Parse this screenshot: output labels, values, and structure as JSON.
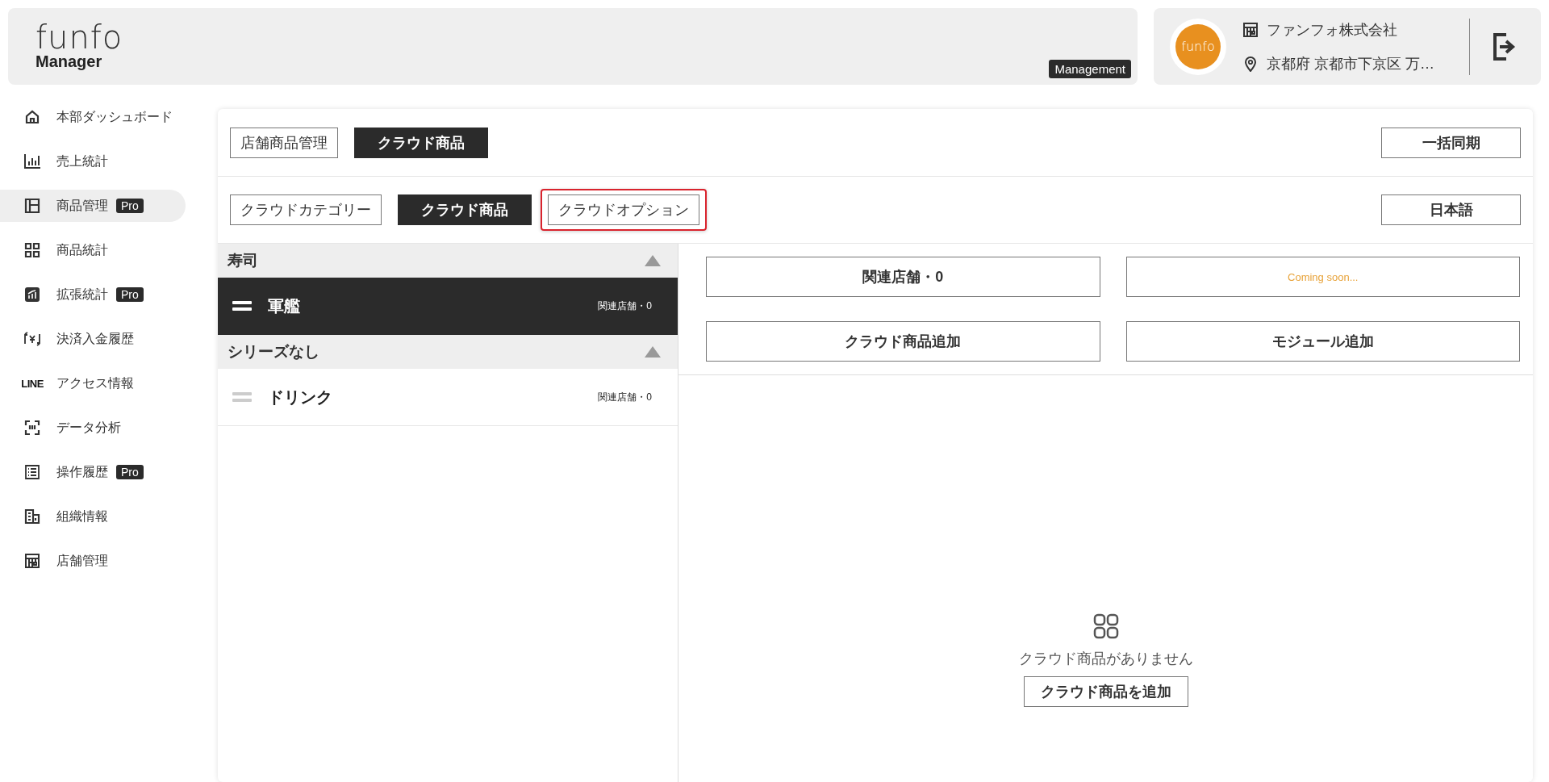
{
  "header": {
    "logo_word": "funfo",
    "logo_sub": "Manager",
    "badge": "Management"
  },
  "account": {
    "avatar_text": "funfo",
    "company": "ファンフォ株式会社",
    "address": "京都府 京都市下京区 万…"
  },
  "sidebar": {
    "items": [
      {
        "label": "本部ダッシュボード",
        "selected": false
      },
      {
        "label": "売上統計",
        "selected": false
      },
      {
        "label": "商品管理",
        "badge": "Pro",
        "selected": true
      },
      {
        "label": "商品統計",
        "selected": false
      },
      {
        "label": "拡張統計",
        "badge": "Pro",
        "selected": false
      },
      {
        "label": "決済入金履歴",
        "selected": false
      },
      {
        "label": "アクセス情報",
        "icon_text": "LINE",
        "selected": false
      },
      {
        "label": "データ分析",
        "selected": false
      },
      {
        "label": "操作履歴",
        "badge": "Pro",
        "selected": false
      },
      {
        "label": "組織情報",
        "selected": false
      },
      {
        "label": "店舗管理",
        "selected": false
      }
    ]
  },
  "tabs": [
    {
      "label": "店舗商品管理",
      "selected": false
    },
    {
      "label": "クラウド商品",
      "selected": true
    }
  ],
  "sync_button": "一括同期",
  "subtabs": [
    {
      "label": "クラウドカテゴリー",
      "selected": false,
      "highlighted": false
    },
    {
      "label": "クラウド商品",
      "selected": true,
      "highlighted": false
    },
    {
      "label": "クラウドオプション",
      "selected": false,
      "highlighted": true
    }
  ],
  "language_button": "日本語",
  "groups": [
    {
      "name": "寿司",
      "expanded": true,
      "items": [
        {
          "name": "軍艦",
          "stores": "関連店舗・0",
          "selected": true
        }
      ]
    },
    {
      "name": "シリーズなし",
      "expanded": true,
      "items": [
        {
          "name": "ドリンク",
          "stores": "関連店舗・0",
          "selected": false
        }
      ]
    }
  ],
  "actions": [
    {
      "label": "関連店舗・0",
      "kind": "normal"
    },
    {
      "label": "Coming soon...",
      "kind": "coming"
    },
    {
      "label": "クラウド商品追加",
      "kind": "normal"
    },
    {
      "label": "モジュール追加",
      "kind": "normal"
    }
  ],
  "empty": {
    "message": "クラウド商品がありません",
    "button": "クラウド商品を追加"
  }
}
